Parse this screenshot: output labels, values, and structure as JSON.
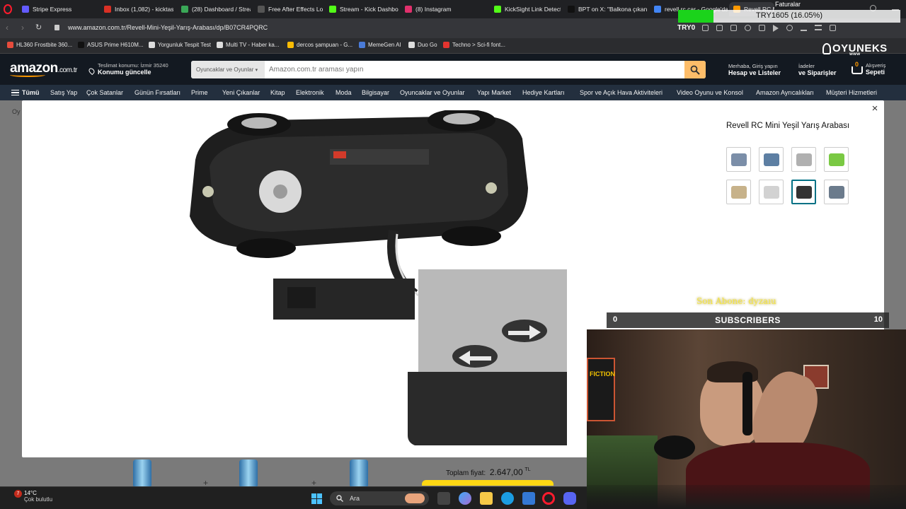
{
  "browser": {
    "tabs": [
      {
        "label": "Stripe Express",
        "color": "#635bff"
      },
      {
        "label": "Inbox (1,082) - kicktaskin",
        "color": "#d93025"
      },
      {
        "label": "(28) Dashboard / Stream",
        "color": "#3aa757"
      },
      {
        "label": "Free After Effects Lower",
        "color": "#555"
      },
      {
        "label": "Stream - Kick Dashboard",
        "color": "#53fc18"
      },
      {
        "label": "(8) Instagram",
        "color": "#e1306c"
      },
      {
        "label": "KickSight Link Detector",
        "color": "#53fc18"
      },
      {
        "label": "BPT on X: \"Balkona çıkan",
        "color": "#111"
      },
      {
        "label": "revell rc car - Google'da",
        "color": "#4285f4"
      },
      {
        "label": "Revell RC Mini Yeşil Yarış",
        "color": "#ff9900"
      }
    ],
    "url": "www.amazon.com.tr/Revell-Mini-Yeşil-Yarış-Arabası/dp/B07CR4PQRC",
    "bookmarks": [
      {
        "label": "HL360 Frostbite 360...",
        "color": "#e74c3c"
      },
      {
        "label": "ASUS Prime H610M...",
        "color": "#111"
      },
      {
        "label": "Yorgunluk Tespit Test",
        "color": "#ddd"
      },
      {
        "label": "Multi TV - Haber ka...",
        "color": "#ddd"
      },
      {
        "label": "dercos şampuan - G...",
        "color": "#fbbc04"
      },
      {
        "label": "MemeGen AI",
        "color": "#4a7bd8"
      },
      {
        "label": "Duo Go",
        "color": "#ddd"
      },
      {
        "label": "Techno > Sci-fi font...",
        "color": "#e3342f"
      }
    ],
    "extension_label": "TRY0"
  },
  "amazon": {
    "logo": "amazon",
    "logo_domain": ".com.tr",
    "delivery_line1": "Teslimat konumu: İzmir 35240",
    "delivery_line2": "Konumu güncelle",
    "search_category": "Oyuncaklar ve Oyunlar",
    "search_placeholder": "Amazon.com.tr araması yapın",
    "account_line1": "Merhaba, Giriş yapın",
    "account_line2": "Hesap ve Listeler",
    "orders_line1": "İadeler",
    "orders_line2": "ve Siparişler",
    "cart_count": "0",
    "cart_line1": "Alışveriş",
    "cart_line2": "Sepeti",
    "subnav": [
      "Tümü",
      "Satış Yap",
      "Çok Satanlar",
      "Günün Fırsatları",
      "Prime",
      "Yeni Çıkanlar",
      "Kitap",
      "Elektronik",
      "Moda",
      "Bilgisayar",
      "Oyuncaklar ve Oyunlar",
      "Yapı Market",
      "Hediye Kartları",
      "Spor ve Açık Hava Aktiviteleri",
      "Video Oyunu ve Konsol",
      "Amazon Ayrıcalıkları",
      "Müşteri Hizmetleri"
    ],
    "breadcrumb_fragment": "Oy",
    "total_label": "Toplam fiyat:",
    "total_value": "2.647,00",
    "total_currency": "TL"
  },
  "modal": {
    "title": "Revell RC Mini Yeşil Yarış Arabası",
    "close_label": "×",
    "thumbnails": [
      {
        "name": "thumb-package-front",
        "selected": false
      },
      {
        "name": "thumb-can-package",
        "selected": false
      },
      {
        "name": "thumb-car-and-remote",
        "selected": false
      },
      {
        "name": "thumb-green-car",
        "selected": false
      },
      {
        "name": "thumb-car-side",
        "selected": false
      },
      {
        "name": "thumb-box-back",
        "selected": false
      },
      {
        "name": "thumb-car-underside",
        "selected": true
      },
      {
        "name": "thumb-box-info",
        "selected": false
      }
    ]
  },
  "stream": {
    "brand": "OYUNEKS",
    "brand_sub": "www",
    "currency_label": "TRY1605 (16.05%)",
    "currency_progress": 0.1605,
    "faturalar": "Faturalar",
    "son_abone": "Son Abone: dyzaıu",
    "subs_label": "SUBSCRIBERS",
    "subs_min": "0",
    "subs_max": "10",
    "poster_text": "FICTION"
  },
  "taskbar": {
    "temp": "14°C",
    "weather": "Çok bulutlu",
    "weather_badge": "7",
    "search_label": "Ara"
  }
}
